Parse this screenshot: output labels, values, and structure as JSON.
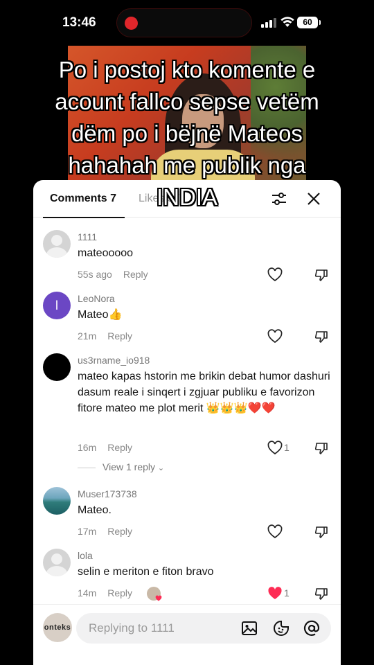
{
  "status_bar": {
    "time": "13:46",
    "battery": "60"
  },
  "caption": "Po i postoj kto komente e\nacount fallco sepse vetëm\ndëm po i bëjnë Mateos\nhahahah me publik nga\nINDIA",
  "tabs": {
    "comments": "Comments 7",
    "likes": "Likes 57"
  },
  "comments": [
    {
      "user": "1111",
      "text": "mateooooo",
      "time": "55s ago",
      "reply": "Reply",
      "likes": "",
      "avatar": "default"
    },
    {
      "user": "LeoNora",
      "text": "Mateo👍",
      "time": "21m",
      "reply": "Reply",
      "likes": "",
      "avatar_letter": "l"
    },
    {
      "user": "us3rname_io918",
      "text": "mateo kapas hstorin me brikin debat humor dashuri dasum reale i sinqert i zgjuar publiku e favorizon fitore mateo me plot merit 👑👑👑❤️❤️",
      "time": "16m",
      "reply": "Reply",
      "likes": "1"
    },
    {
      "user": "Muser173738",
      "text": "Mateo.",
      "time": "17m",
      "reply": "Reply",
      "likes": ""
    },
    {
      "user": "lola",
      "text": "selin e meriton e fiton bravo",
      "time": "14m",
      "reply": "Reply",
      "likes": "1",
      "liked": true
    }
  ],
  "view_replies": "View 1 reply",
  "input": {
    "placeholder": "Replying to 1111",
    "avatar_text": "onteks"
  },
  "colors": {
    "like_red": "#fe2c55",
    "accent_purple": "#6b47c4"
  }
}
